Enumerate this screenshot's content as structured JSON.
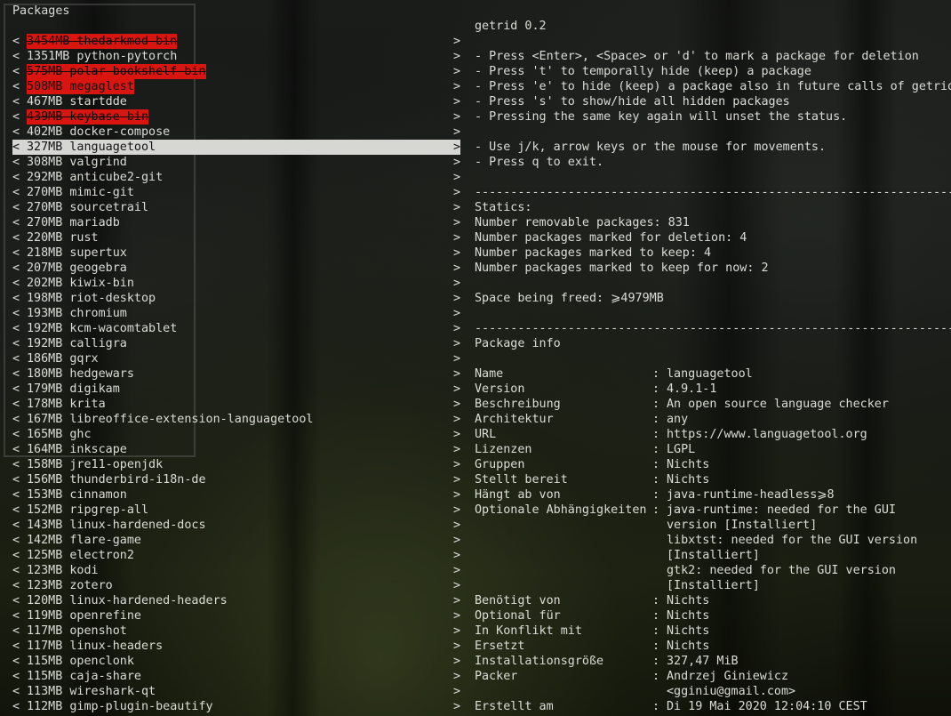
{
  "left_pane": {
    "title": "Packages",
    "packages": [
      {
        "lt": "<",
        "text": "3454MB thedarkmod-bin",
        "gt": ">",
        "state": "marked"
      },
      {
        "lt": "<",
        "text": "1351MB python-pytorch",
        "gt": ">",
        "state": "normal"
      },
      {
        "lt": "<",
        "text": "575MB polar-bookshelf-bin",
        "gt": ">",
        "state": "marked"
      },
      {
        "lt": "<",
        "text": "508MB megaglest",
        "gt": ">",
        "state": "hidden"
      },
      {
        "lt": "<",
        "text": "467MB startdde",
        "gt": ">",
        "state": "normal"
      },
      {
        "lt": "<",
        "text": "439MB keybase-bin",
        "gt": ">",
        "state": "marked"
      },
      {
        "lt": "<",
        "text": "402MB docker-compose",
        "gt": ">",
        "state": "normal"
      },
      {
        "lt": "<",
        "text": "327MB languagetool",
        "gt": ">",
        "state": "selected"
      },
      {
        "lt": "<",
        "text": "308MB valgrind",
        "gt": ">",
        "state": "normal"
      },
      {
        "lt": "<",
        "text": "292MB anticube2-git",
        "gt": ">",
        "state": "normal"
      },
      {
        "lt": "<",
        "text": "270MB mimic-git",
        "gt": ">",
        "state": "normal"
      },
      {
        "lt": "<",
        "text": "270MB sourcetrail",
        "gt": ">",
        "state": "normal"
      },
      {
        "lt": "<",
        "text": "270MB mariadb",
        "gt": ">",
        "state": "normal"
      },
      {
        "lt": "<",
        "text": "220MB rust",
        "gt": ">",
        "state": "normal"
      },
      {
        "lt": "<",
        "text": "218MB supertux",
        "gt": ">",
        "state": "normal"
      },
      {
        "lt": "<",
        "text": "207MB geogebra",
        "gt": ">",
        "state": "normal"
      },
      {
        "lt": "<",
        "text": "202MB kiwix-bin",
        "gt": ">",
        "state": "normal"
      },
      {
        "lt": "<",
        "text": "198MB riot-desktop",
        "gt": ">",
        "state": "normal"
      },
      {
        "lt": "<",
        "text": "193MB chromium",
        "gt": ">",
        "state": "normal"
      },
      {
        "lt": "<",
        "text": "192MB kcm-wacomtablet",
        "gt": ">",
        "state": "normal"
      },
      {
        "lt": "<",
        "text": "192MB calligra",
        "gt": ">",
        "state": "normal"
      },
      {
        "lt": "<",
        "text": "186MB gqrx",
        "gt": ">",
        "state": "normal"
      },
      {
        "lt": "<",
        "text": "180MB hedgewars",
        "gt": ">",
        "state": "normal"
      },
      {
        "lt": "<",
        "text": "179MB digikam",
        "gt": ">",
        "state": "normal"
      },
      {
        "lt": "<",
        "text": "178MB krita",
        "gt": ">",
        "state": "normal"
      },
      {
        "lt": "<",
        "text": "167MB libreoffice-extension-languagetool",
        "gt": ">",
        "state": "normal"
      },
      {
        "lt": "<",
        "text": "165MB ghc",
        "gt": ">",
        "state": "normal"
      },
      {
        "lt": "<",
        "text": "164MB inkscape",
        "gt": ">",
        "state": "normal"
      },
      {
        "lt": "<",
        "text": "158MB jre11-openjdk",
        "gt": ">",
        "state": "normal"
      },
      {
        "lt": "<",
        "text": "156MB thunderbird-i18n-de",
        "gt": ">",
        "state": "normal"
      },
      {
        "lt": "<",
        "text": "153MB cinnamon",
        "gt": ">",
        "state": "normal"
      },
      {
        "lt": "<",
        "text": "152MB ripgrep-all",
        "gt": ">",
        "state": "normal"
      },
      {
        "lt": "<",
        "text": "143MB linux-hardened-docs",
        "gt": ">",
        "state": "normal"
      },
      {
        "lt": "<",
        "text": "142MB flare-game",
        "gt": ">",
        "state": "normal"
      },
      {
        "lt": "<",
        "text": "125MB electron2",
        "gt": ">",
        "state": "normal"
      },
      {
        "lt": "<",
        "text": "123MB kodi",
        "gt": ">",
        "state": "normal"
      },
      {
        "lt": "<",
        "text": "123MB zotero",
        "gt": ">",
        "state": "normal"
      },
      {
        "lt": "<",
        "text": "120MB linux-hardened-headers",
        "gt": ">",
        "state": "normal"
      },
      {
        "lt": "<",
        "text": "119MB openrefine",
        "gt": ">",
        "state": "normal"
      },
      {
        "lt": "<",
        "text": "117MB openshot",
        "gt": ">",
        "state": "normal"
      },
      {
        "lt": "<",
        "text": "117MB linux-headers",
        "gt": ">",
        "state": "normal"
      },
      {
        "lt": "<",
        "text": "115MB openclonk",
        "gt": ">",
        "state": "normal"
      },
      {
        "lt": "<",
        "text": "115MB caja-share",
        "gt": ">",
        "state": "normal"
      },
      {
        "lt": "<",
        "text": "113MB wireshark-qt",
        "gt": ">",
        "state": "normal"
      },
      {
        "lt": "<",
        "text": "112MB gimp-plugin-beautify",
        "gt": ">",
        "state": "normal"
      }
    ]
  },
  "right_pane": {
    "app_title": "getrid 0.2",
    "help_lines": [
      "- Press <Enter>, <Space> or 'd' to mark a package for deletion",
      "- Press 't' to temporally hide (keep) a package",
      "- Press 'e' to hide (keep) a package also in future calls of getrid",
      "- Press 's' to show/hide all hidden packages",
      "- Pressing the same key again will unset the status."
    ],
    "nav_lines": [
      "- Use j/k, arrow keys or the mouse for movements.",
      "- Press q to exit."
    ],
    "divider": "-------------------------------------------------------------------",
    "statics_title": "Statics:",
    "statics_lines": [
      "Number removable packages: 831",
      "Number packages marked for deletion: 4",
      "Number packages marked to keep: 4",
      "Number packages marked to keep for now: 2"
    ],
    "space_freed": "Space being freed: ⩾4979MB",
    "package_info_title": "Package info",
    "info_sep": ":",
    "info": [
      {
        "key": "Name",
        "value": "languagetool"
      },
      {
        "key": "Version",
        "value": "4.9.1-1"
      },
      {
        "key": "Beschreibung",
        "value": "An open source language checker"
      },
      {
        "key": "Architektur",
        "value": "any"
      },
      {
        "key": "URL",
        "value": "https://www.languagetool.org"
      },
      {
        "key": "Lizenzen",
        "value": "LGPL"
      },
      {
        "key": "Gruppen",
        "value": "Nichts"
      },
      {
        "key": "Stellt bereit",
        "value": "Nichts"
      },
      {
        "key": "Hängt ab von",
        "value": "java-runtime-headless⩾8"
      },
      {
        "key": "Optionale Abhängigkeiten",
        "value": "java-runtime: needed for the GUI"
      },
      {
        "key": "",
        "value": "version [Installiert]"
      },
      {
        "key": "",
        "value": "libxtst: needed for the GUI version"
      },
      {
        "key": "",
        "value": "[Installiert]"
      },
      {
        "key": "",
        "value": "gtk2: needed for the GUI version"
      },
      {
        "key": "",
        "value": "[Installiert]"
      },
      {
        "key": "Benötigt von",
        "value": "Nichts"
      },
      {
        "key": "Optional für",
        "value": "Nichts"
      },
      {
        "key": "In Konflikt mit",
        "value": "Nichts"
      },
      {
        "key": "Ersetzt",
        "value": "Nichts"
      },
      {
        "key": "Installationsgröße",
        "value": "327,47 MiB"
      },
      {
        "key": "Packer",
        "value": "Andrzej Giniewicz"
      },
      {
        "key": "",
        "value": "<gginiu@gmail.com>"
      },
      {
        "key": "Erstellt am",
        "value": "Di 19 Mai 2020 12:04:10 CEST"
      }
    ]
  },
  "colors": {
    "marked_bg": "#d8150f",
    "selected_bg": "#d6d6d2",
    "text": "#dcdcd6"
  }
}
